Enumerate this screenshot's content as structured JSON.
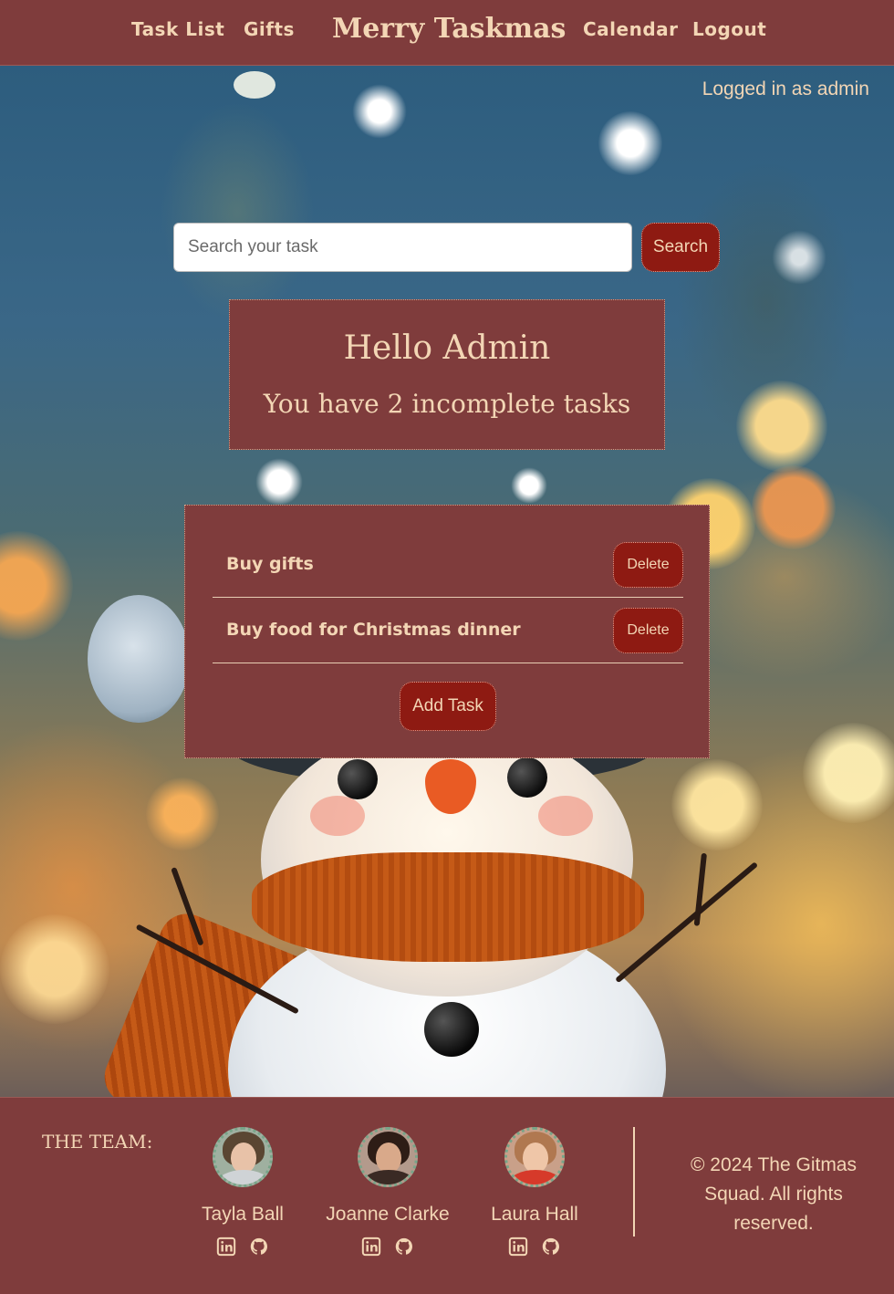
{
  "nav": {
    "links": [
      "Task List",
      "Gifts",
      "Calendar",
      "Logout"
    ],
    "brand": "Merry Taskmas"
  },
  "user": {
    "status": "Logged in as admin"
  },
  "search": {
    "placeholder": "Search your task",
    "value": "",
    "button": "Search"
  },
  "greeting": {
    "title": "Hello Admin",
    "subtitle": "You have 2 incomplete tasks"
  },
  "tasks": {
    "items": [
      {
        "name": "Buy gifts",
        "delete_label": "Delete"
      },
      {
        "name": "Buy food for Christmas dinner",
        "delete_label": "Delete"
      }
    ],
    "add_label": "Add Task"
  },
  "footer": {
    "team_label": "THE TEAM:",
    "members": [
      {
        "name": "Tayla Ball",
        "icons": [
          "linkedin-icon",
          "github-icon"
        ]
      },
      {
        "name": "Joanne Clarke",
        "icons": [
          "linkedin-icon",
          "github-icon"
        ]
      },
      {
        "name": "Laura Hall",
        "icons": [
          "linkedin-icon",
          "github-icon"
        ]
      }
    ],
    "copyright": "© 2024 The Gitmas Squad. All rights reserved."
  },
  "colors": {
    "primary": "#7f3c3c",
    "button": "#8e1a12",
    "text": "#f3d6b5"
  }
}
